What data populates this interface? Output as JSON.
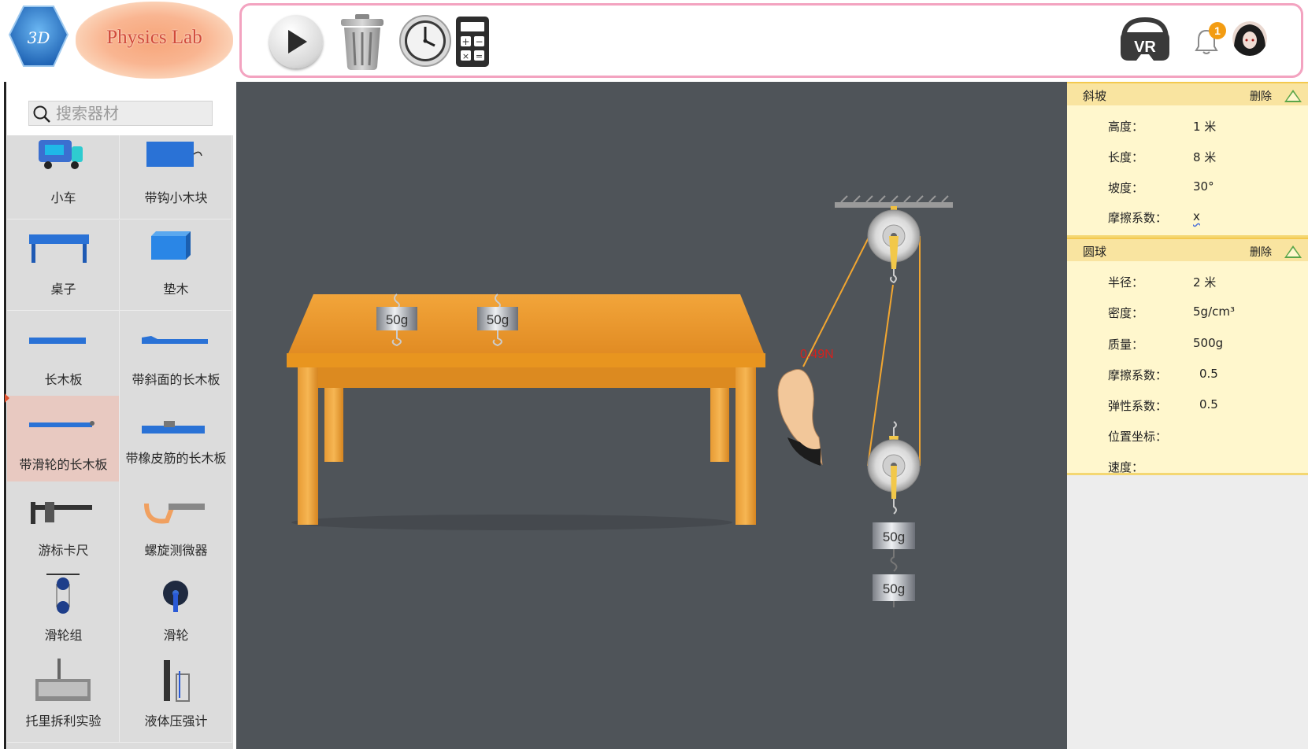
{
  "app": {
    "logo_text": "3D",
    "title": "Physics Lab"
  },
  "toolbar": {
    "play": "play-icon",
    "trash": "trash-icon",
    "clock": "clock-icon",
    "calculator": "calculator-icon",
    "vr": "vr-headset-icon",
    "bell": "bell-icon",
    "notification_count": "1",
    "border_color": "#f3a3c0"
  },
  "search": {
    "placeholder": "搜索器材",
    "value": ""
  },
  "sidebar": {
    "items": [
      {
        "label": "小车",
        "icon": "cart-icon"
      },
      {
        "label": "带钩小木块",
        "icon": "hook-block-icon"
      },
      {
        "label": "桌子",
        "icon": "table-icon"
      },
      {
        "label": "垫木",
        "icon": "wood-block-icon"
      },
      {
        "label": "长木板",
        "icon": "long-board-icon"
      },
      {
        "label": "带斜面的长木板",
        "icon": "slope-board-icon"
      },
      {
        "label": "带滑轮的长木板",
        "icon": "pulley-board-icon",
        "selected": true
      },
      {
        "label": "带橡皮筋的长木板",
        "icon": "rubber-band-board-icon"
      },
      {
        "label": "游标卡尺",
        "icon": "vernier-caliper-icon"
      },
      {
        "label": "螺旋测微器",
        "icon": "micrometer-icon"
      },
      {
        "label": "滑轮组",
        "icon": "pulley-block-icon"
      },
      {
        "label": "滑轮",
        "icon": "pulley-icon"
      },
      {
        "label": "托里拆利实验",
        "icon": "torricelli-icon"
      },
      {
        "label": "液体压强计",
        "icon": "pressure-gauge-icon"
      }
    ]
  },
  "scene": {
    "weights_on_table": [
      "50g",
      "50g"
    ],
    "hanging_weights": [
      "50g",
      "50g"
    ],
    "force_reading": "0.49N",
    "background": "#4f5459"
  },
  "properties": {
    "sections": [
      {
        "title": "斜坡",
        "delete_label": "删除",
        "rows": [
          {
            "label": "高度：",
            "value": "1 米"
          },
          {
            "label": "长度：",
            "value": "8 米"
          },
          {
            "label": "坡度：",
            "value": "30°"
          },
          {
            "label": "摩擦系数：",
            "value": "x"
          }
        ]
      },
      {
        "title": "圆球",
        "delete_label": "删除",
        "rows": [
          {
            "label": "半径：",
            "value": "2 米"
          },
          {
            "label": "密度：",
            "value": "5g/cm³"
          },
          {
            "label": "质量：",
            "value": "500g"
          },
          {
            "label": "摩擦系数：",
            "value": "0.5"
          },
          {
            "label": "弹性系数：",
            "value": "0.5"
          },
          {
            "label": "位置坐标：",
            "value": ""
          },
          {
            "label": "速度：",
            "value": ""
          }
        ]
      }
    ]
  }
}
